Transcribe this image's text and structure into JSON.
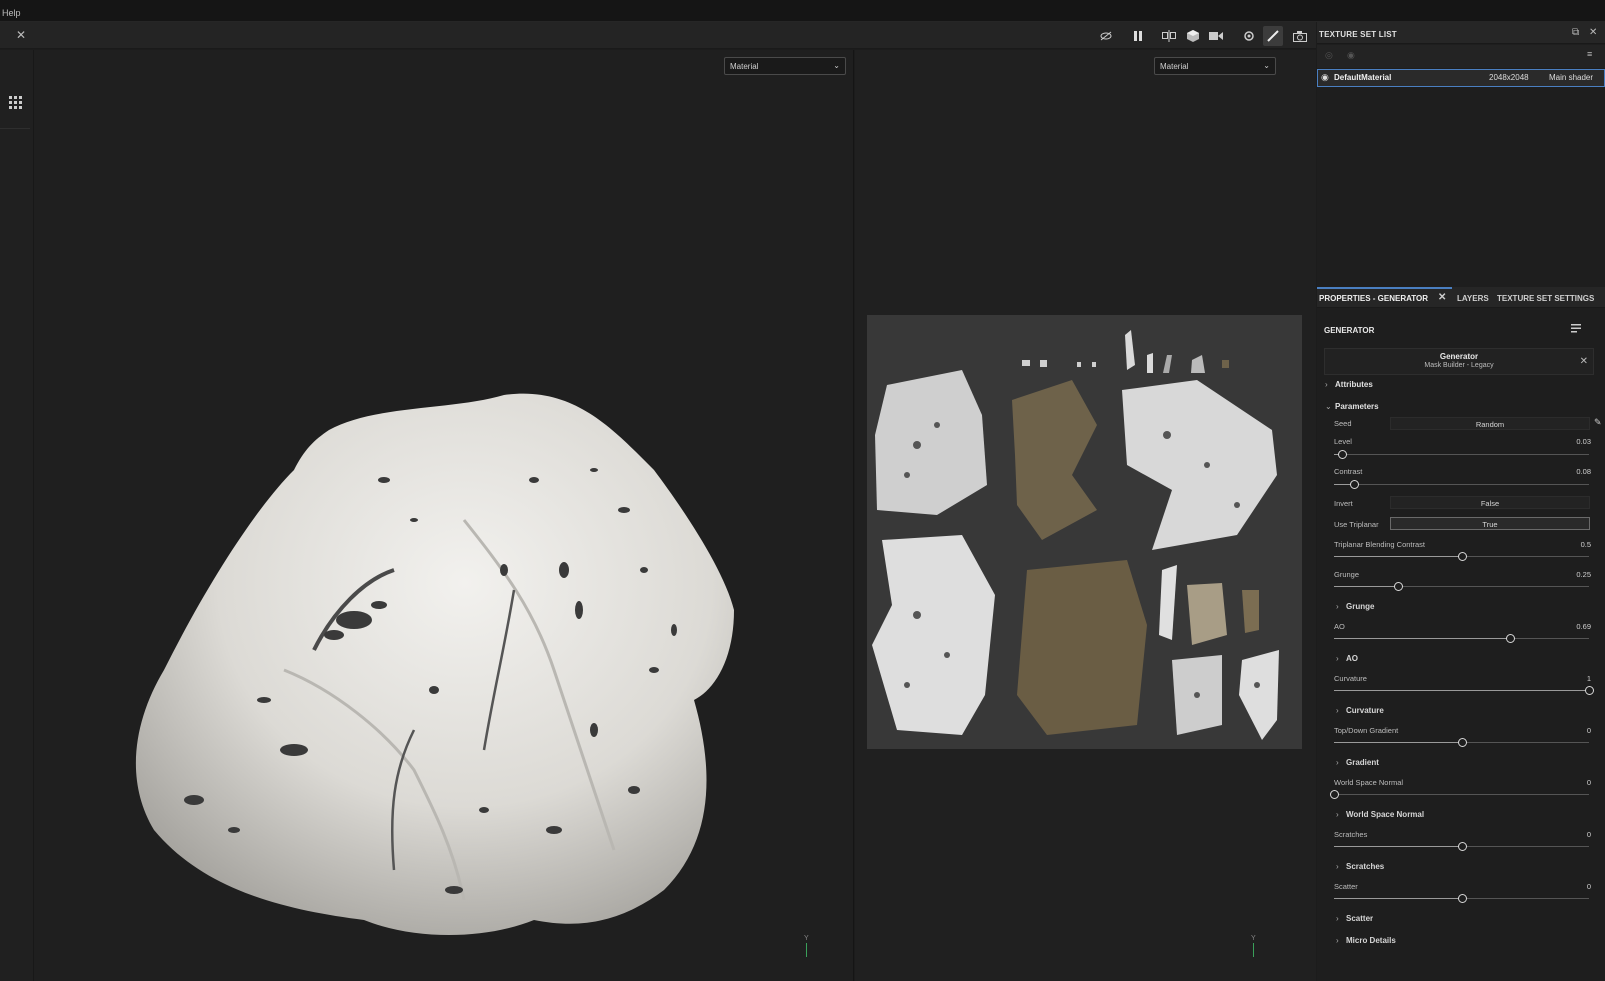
{
  "menubar": {
    "help": "Help"
  },
  "toolbar": {
    "close": "✕",
    "icons": [
      "hide-icon",
      "pause-icon",
      "split-view-icon",
      "cube-icon",
      "camera-icon",
      "brush-settings-icon",
      "paint-brush-icon",
      "screenshot-icon"
    ]
  },
  "viewport3d": {
    "dropdown": "Material",
    "axis_label": "Y"
  },
  "viewport2d": {
    "dropdown": "Material",
    "axis_label": "Y"
  },
  "texture_set_list": {
    "title": "TEXTURE SET LIST",
    "row": {
      "name": "DefaultMaterial",
      "resolution": "2048x2048",
      "shader": "Main shader"
    }
  },
  "tabs": {
    "properties": "PROPERTIES - GENERATOR",
    "layers": "LAYERS",
    "texture_set_settings": "TEXTURE SET SETTINGS"
  },
  "generator": {
    "header": "GENERATOR",
    "name": "Generator",
    "subtitle": "Mask Builder - Legacy",
    "attributes": "Attributes",
    "parameters": "Parameters",
    "seed": {
      "label": "Seed",
      "value": "Random"
    },
    "level": {
      "label": "Level",
      "value": "0.03",
      "fraction": 0.03
    },
    "contrast": {
      "label": "Contrast",
      "value": "0.08",
      "fraction": 0.08
    },
    "invert": {
      "label": "Invert",
      "value": "False"
    },
    "use_triplanar": {
      "label": "Use Triplanar",
      "value": "True"
    },
    "triplanar_blending": {
      "label": "Triplanar Blending Contrast",
      "value": "0.5",
      "fraction": 0.5
    },
    "grunge": {
      "label": "Grunge",
      "value": "0.25",
      "fraction": 0.25,
      "section": "Grunge"
    },
    "ao": {
      "label": "AO",
      "value": "0.69",
      "fraction": 0.69,
      "section": "AO"
    },
    "curvature": {
      "label": "Curvature",
      "value": "1",
      "fraction": 1.0,
      "section": "Curvature"
    },
    "topdown": {
      "label": "Top/Down Gradient",
      "value": "0",
      "fraction": 0.5,
      "section": "Gradient"
    },
    "wsn": {
      "label": "World Space Normal",
      "value": "0",
      "fraction": 0.0,
      "section": "World Space Normal"
    },
    "scratches": {
      "label": "Scratches",
      "value": "0",
      "fraction": 0.5,
      "section": "Scratches"
    },
    "scatter": {
      "label": "Scatter",
      "value": "0",
      "fraction": 0.5,
      "section": "Scatter"
    },
    "micro_details": "Micro Details"
  },
  "colors": {
    "accent": "#4a7fc1",
    "background": "#1c1c1c",
    "panel": "#1e1e1e"
  }
}
